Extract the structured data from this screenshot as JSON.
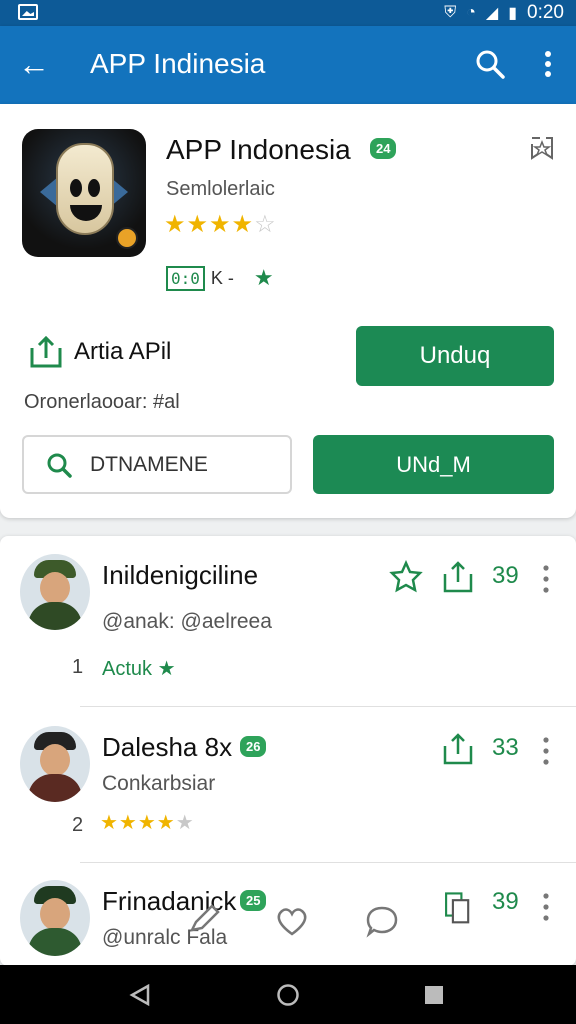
{
  "status_bar": {
    "time": "0:20",
    "icons": [
      "gallery-icon",
      "shield-icon",
      "wifi-icon",
      "signal-icon",
      "battery-icon"
    ]
  },
  "app_bar": {
    "title": "APP Indinesia",
    "icons": [
      "back-arrow-icon",
      "search-icon",
      "more-vert-icon"
    ]
  },
  "app": {
    "name": "APP Indonesia",
    "badge": "24",
    "subtitle": "Semlolerlaic",
    "rating": {
      "stars": 4,
      "max": 5
    },
    "meta_box": "0:0",
    "meta_text": "K -"
  },
  "share": {
    "label": "Artia APil",
    "caption": "Oronerlaooar: #al"
  },
  "buttons": {
    "unduh": "Unduq",
    "unduh2": "UNd_M"
  },
  "search": {
    "value": "DTNAMENE"
  },
  "list": [
    {
      "name": "Inildenigciline",
      "handle": "@anak: @aelreea",
      "index": "1",
      "status": "Actuk",
      "count": "39"
    },
    {
      "name": "Dalesha 8x",
      "badge": "26",
      "handle": "Conkarbsiar",
      "index": "2",
      "rating": 4,
      "count": "33"
    },
    {
      "name": "Frinadanick",
      "badge": "25",
      "handle": "@unralc Fala",
      "count": "39"
    }
  ],
  "colors": {
    "app_bar": "#1373bd",
    "status_bar": "#0d5a97",
    "accent_green": "#1c8a54",
    "star": "#f0b400"
  }
}
